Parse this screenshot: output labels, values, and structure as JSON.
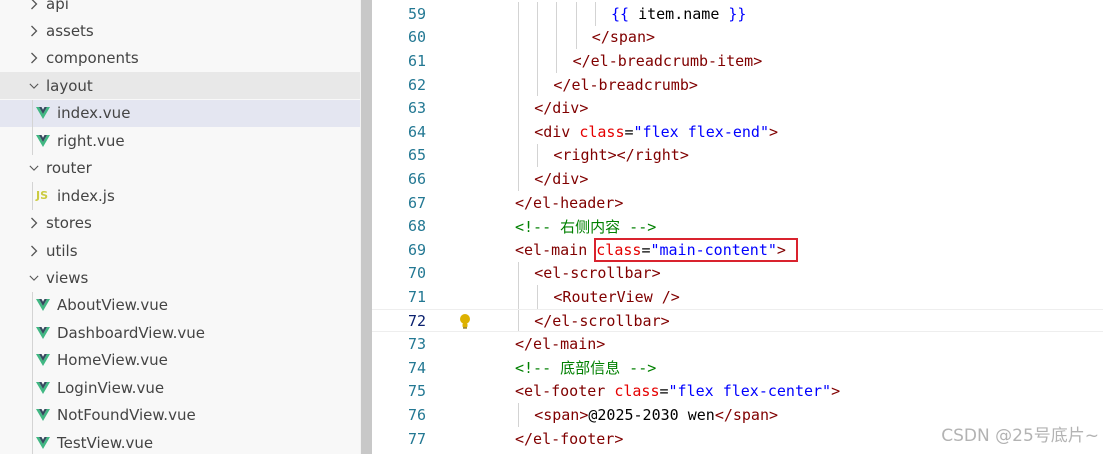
{
  "explorer": {
    "items": [
      {
        "label": "api",
        "kind": "folder",
        "state": "collapsed"
      },
      {
        "label": "assets",
        "kind": "folder",
        "state": "collapsed"
      },
      {
        "label": "components",
        "kind": "folder",
        "state": "collapsed"
      },
      {
        "label": "layout",
        "kind": "folder",
        "state": "expanded"
      },
      {
        "label": "index.vue",
        "kind": "vue-file",
        "state": "selected"
      },
      {
        "label": "right.vue",
        "kind": "vue-file"
      },
      {
        "label": "router",
        "kind": "folder",
        "state": "expanded"
      },
      {
        "label": "index.js",
        "kind": "js-file",
        "badge": "JS"
      },
      {
        "label": "stores",
        "kind": "folder",
        "state": "collapsed"
      },
      {
        "label": "utils",
        "kind": "folder",
        "state": "collapsed"
      },
      {
        "label": "views",
        "kind": "folder",
        "state": "expanded"
      },
      {
        "label": "AboutView.vue",
        "kind": "vue-file"
      },
      {
        "label": "DashboardView.vue",
        "kind": "vue-file"
      },
      {
        "label": "HomeView.vue",
        "kind": "vue-file"
      },
      {
        "label": "LoginView.vue",
        "kind": "vue-file"
      },
      {
        "label": "NotFoundView.vue",
        "kind": "vue-file"
      },
      {
        "label": "TestView.vue",
        "kind": "vue-file"
      }
    ]
  },
  "editor": {
    "current_line": "72",
    "lines": [
      {
        "n": "59",
        "indent": 5,
        "tokens": [
          [
            "mus",
            "{{ "
          ],
          [
            "txt",
            "item.name"
          ],
          [
            "mus",
            " }}"
          ]
        ]
      },
      {
        "n": "60",
        "indent": 4,
        "tokens": [
          [
            "tag",
            "</span>"
          ]
        ]
      },
      {
        "n": "61",
        "indent": 3,
        "tokens": [
          [
            "tag",
            "</el-breadcrumb-item>"
          ]
        ]
      },
      {
        "n": "62",
        "indent": 2,
        "tokens": [
          [
            "tag",
            "</el-breadcrumb>"
          ]
        ]
      },
      {
        "n": "63",
        "indent": 1,
        "tokens": [
          [
            "tag",
            "</div>"
          ]
        ]
      },
      {
        "n": "64",
        "indent": 1,
        "tokens": [
          [
            "tag",
            "<div "
          ],
          [
            "attr",
            "class"
          ],
          [
            "txt",
            "="
          ],
          [
            "str",
            "\"flex flex-end\""
          ],
          [
            "tag",
            ">"
          ]
        ]
      },
      {
        "n": "65",
        "indent": 2,
        "tokens": [
          [
            "tag",
            "<right></right>"
          ]
        ]
      },
      {
        "n": "66",
        "indent": 1,
        "tokens": [
          [
            "tag",
            "</div>"
          ]
        ]
      },
      {
        "n": "67",
        "indent": 0,
        "tokens": [
          [
            "tag",
            "</el-header>"
          ]
        ]
      },
      {
        "n": "68",
        "indent": 0,
        "tokens": [
          [
            "cmt",
            "<!-- 右侧内容 -->"
          ]
        ]
      },
      {
        "n": "69",
        "indent": 0,
        "tokens": [
          [
            "tag",
            "<el-main "
          ],
          [
            "attr",
            "class"
          ],
          [
            "txt",
            "="
          ],
          [
            "str",
            "\"main-content\""
          ],
          [
            "tag",
            ">"
          ]
        ]
      },
      {
        "n": "70",
        "indent": 1,
        "tokens": [
          [
            "tag",
            "<el-scrollbar>"
          ]
        ]
      },
      {
        "n": "71",
        "indent": 2,
        "tokens": [
          [
            "tag",
            "<RouterView />"
          ]
        ]
      },
      {
        "n": "72",
        "indent": 1,
        "tokens": [
          [
            "tag",
            "</el-scrollbar>"
          ]
        ]
      },
      {
        "n": "73",
        "indent": 0,
        "tokens": [
          [
            "tag",
            "</el-main>"
          ]
        ]
      },
      {
        "n": "74",
        "indent": 0,
        "tokens": [
          [
            "cmt",
            "<!-- 底部信息 -->"
          ]
        ]
      },
      {
        "n": "75",
        "indent": 0,
        "tokens": [
          [
            "tag",
            "<el-footer "
          ],
          [
            "attr",
            "class"
          ],
          [
            "txt",
            "="
          ],
          [
            "str",
            "\"flex flex-center\""
          ],
          [
            "tag",
            ">"
          ]
        ]
      },
      {
        "n": "76",
        "indent": 1,
        "tokens": [
          [
            "tag",
            "<span>"
          ],
          [
            "txt",
            "@2025-2030 wen"
          ],
          [
            "tag",
            "</span>"
          ]
        ]
      },
      {
        "n": "77",
        "indent": 0,
        "tokens": [
          [
            "tag",
            "</el-footer>"
          ]
        ]
      }
    ]
  },
  "watermark": "CSDN @25号底片~",
  "colors": {
    "tag": "#800000",
    "attr": "#e50000",
    "string": "#0000ff",
    "comment": "#008000",
    "line_number": "#237893",
    "vue_icon": "#41b883",
    "highlight_box": "#d9232e"
  }
}
